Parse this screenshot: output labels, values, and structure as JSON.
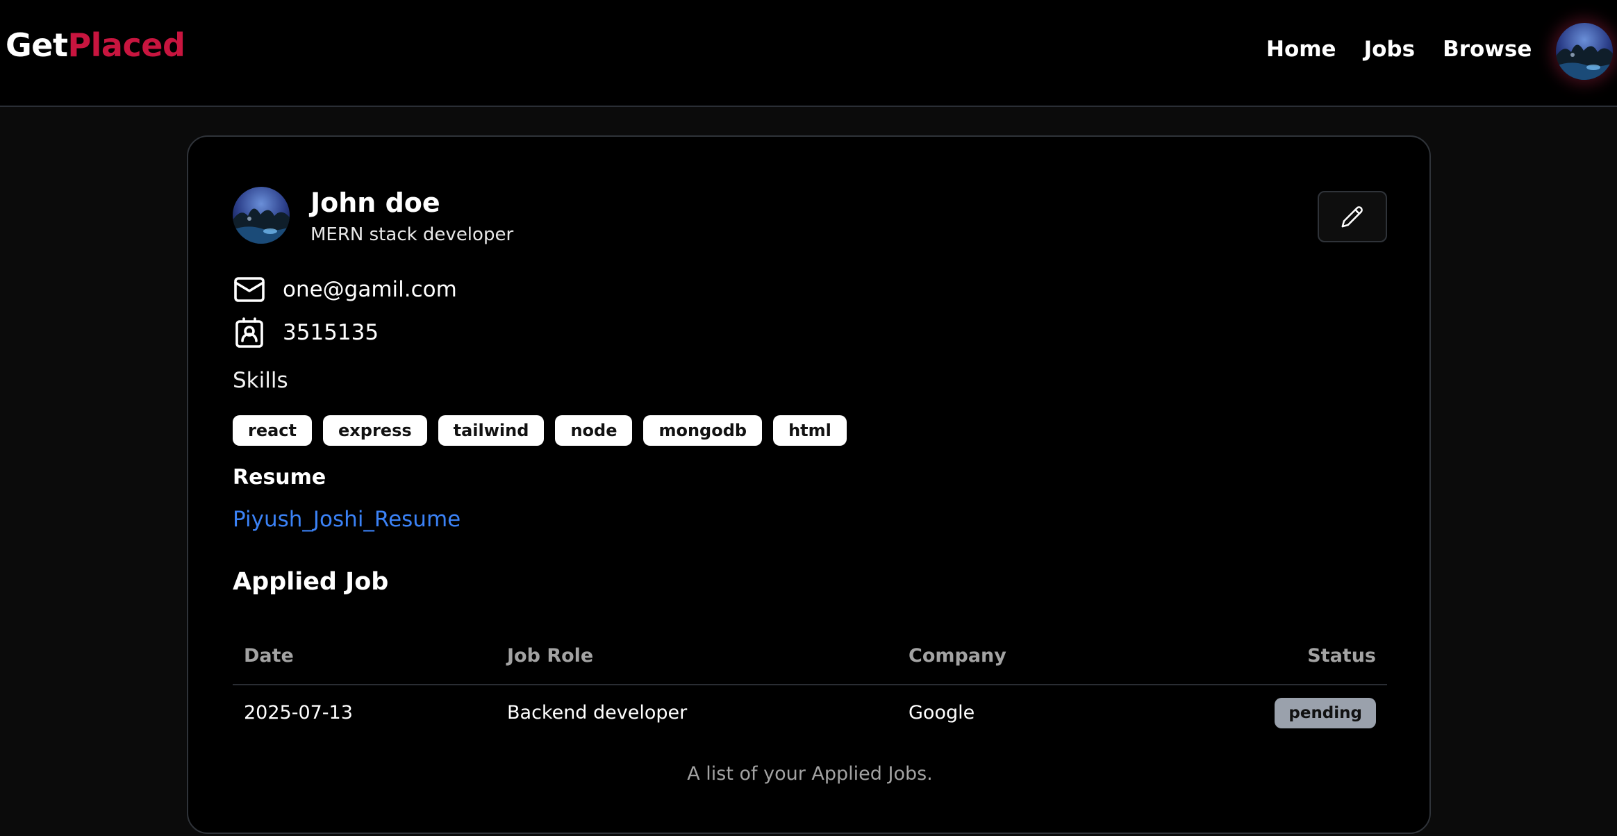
{
  "navbar": {
    "logo_part1": "Get",
    "logo_part2": "Placed",
    "links": [
      "Home",
      "Jobs",
      "Browse"
    ]
  },
  "profile": {
    "name": "John doe",
    "title": "MERN stack developer",
    "email": "one@gamil.com",
    "phone": "3515135",
    "skills_label": "Skills",
    "skills": [
      "react",
      "express",
      "tailwind",
      "node",
      "mongodb",
      "html"
    ],
    "resume_label": "Resume",
    "resume_link": "Piyush_Joshi_Resume"
  },
  "applied": {
    "title": "Applied Job",
    "headers": {
      "date": "Date",
      "role": "Job Role",
      "company": "Company",
      "status": "Status"
    },
    "rows": [
      {
        "date": "2025-07-13",
        "role": "Backend developer",
        "company": "Google",
        "status": "pending"
      }
    ],
    "caption": "A list of your Applied Jobs."
  },
  "colors": {
    "brand_red": "#c8153f",
    "link_blue": "#3b82f6",
    "pending_badge": "#9aa1ac"
  },
  "icons": {
    "edit": "pencil-icon",
    "email": "mail-icon",
    "phone": "contact-icon"
  }
}
